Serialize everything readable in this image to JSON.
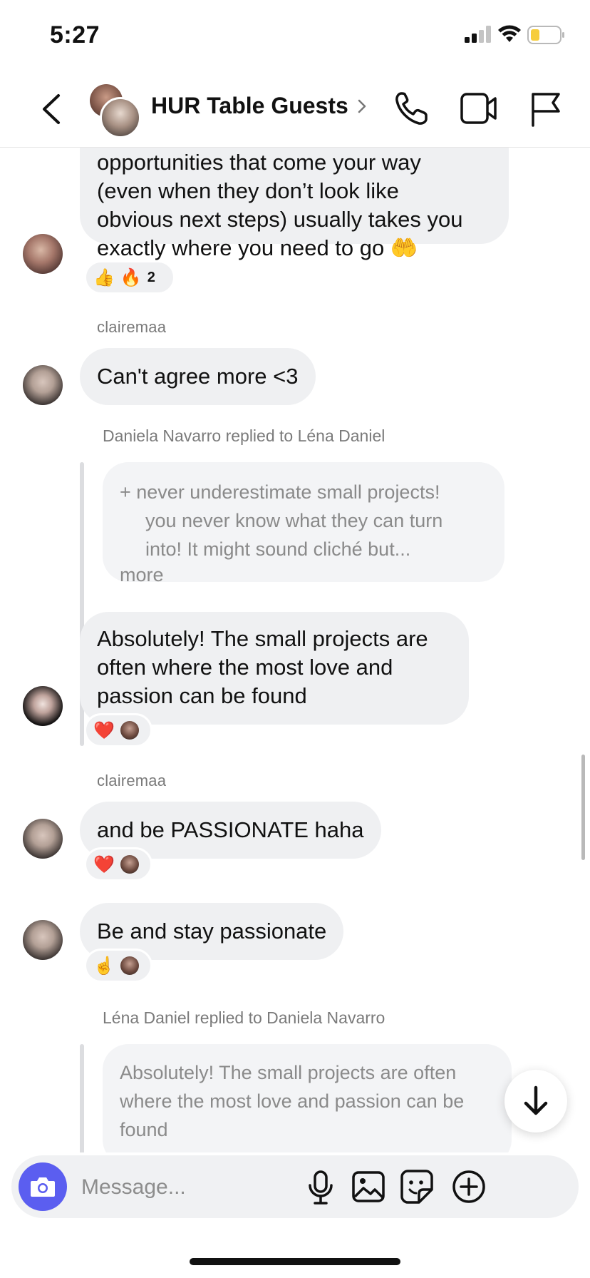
{
  "status_bar": {
    "time": "5:27"
  },
  "header": {
    "title": "HUR Table Guests"
  },
  "messages": {
    "m1_lines": [
      "opportunities that come your way",
      "(even when they don’t look like",
      "obvious next steps) usually takes you",
      "exactly where you need to go 🤲"
    ],
    "m1_reactions": {
      "emoji_1": "👍",
      "emoji_2": "🔥",
      "count": "2"
    },
    "m2_sender": "clairemaa",
    "m2_text": "Can't agree more <3",
    "reply1_label": "Daniela Navarro replied to Léna Daniel",
    "reply1_quote": {
      "line1": "+ never underestimate small projects!",
      "line2": "you never know what they can turn",
      "line3": "into! It might sound cliché but...",
      "more": "more"
    },
    "m3_lines": [
      "Absolutely! The small projects are",
      "often where the most love and",
      "passion can be found"
    ],
    "m3_reaction": "❤️",
    "m4_sender": "clairemaa",
    "m4_text": "and be PASSIONATE haha",
    "m4_reaction": "❤️",
    "m5_text": "Be and stay passionate",
    "m5_reaction": "☝️",
    "reply2_label": "Léna Daniel replied to Daniela Navarro",
    "reply2_quote": {
      "line1": "Absolutely! The small projects are often",
      "line2": "where the most love and passion can be",
      "line3": "found"
    }
  },
  "composer": {
    "placeholder": "Message..."
  },
  "colors": {
    "accent": "#5b5ef0",
    "bubble": "#eff0f2"
  }
}
